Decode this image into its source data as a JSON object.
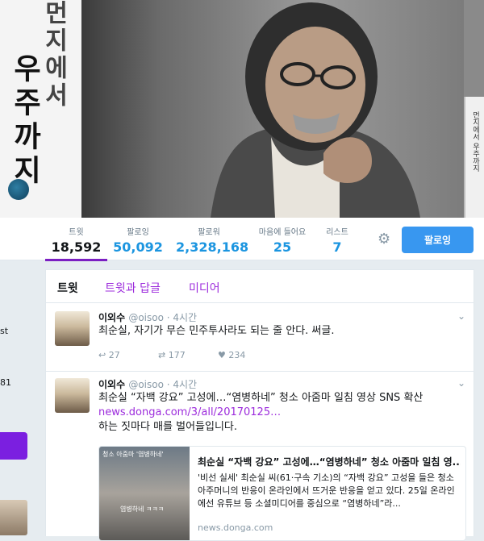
{
  "banner": {
    "book_title_top": "먼지에서",
    "book_title_bottom": "우주까지",
    "spine_text": "먼지에서 우주까지"
  },
  "stats": [
    {
      "label": "트윗",
      "value": "18,592"
    },
    {
      "label": "팔로잉",
      "value": "50,092"
    },
    {
      "label": "팔로워",
      "value": "2,328,168"
    },
    {
      "label": "마음에 들어요",
      "value": "25"
    },
    {
      "label": "리스트",
      "value": "7"
    }
  ],
  "follow_button": "팔로잉",
  "sidebar_fragments": [
    "st",
    "81"
  ],
  "tabs": [
    {
      "label": "트윗"
    },
    {
      "label": "트윗과 답글"
    },
    {
      "label": "미디어"
    }
  ],
  "tweets": [
    {
      "name": "이외수",
      "handle": "@oisoo · 4시간",
      "text": "최순실, 자기가 무슨 민주투사라도 되는 줄 안다. 써글.",
      "reply_count": "27",
      "retweet_count": "177",
      "like_count": "234"
    },
    {
      "name": "이외수",
      "handle": "@oisoo · 4시간",
      "text_line1": "최순실 “자백 강요” 고성에…“염병하네” 청소 아줌마 일침 영상 SNS 확산",
      "link": "news.donga.com/3/all/20170125…",
      "text_line3": "하는 짓마다 매를 벌어들입니다.",
      "card": {
        "image_tag": "청소 아줌마 '염병하네'",
        "image_caption": "염병하네 ㅋㅋㅋ",
        "title": "최순실 “자백 강요” 고성에…“염병하네” 청소 아줌마 일침 영...",
        "description": "'비선 실세' 최순실 씨(61·구속 기소)의 “자백 강요” 고성을 들은 청소 아주머니의 반응이 온라인에서 뜨거운 반응을 얻고 있다. 25일 온라인에선 유튜브 등 소셜미디어를 중심으로 “염병하네”라...",
        "domain": "news.donga.com"
      }
    }
  ],
  "colors": {
    "accent": "#9c2bdc",
    "link_blue": "#1b95e0",
    "button_blue": "#3897f0",
    "tab_indicator": "#7b1fc2"
  }
}
